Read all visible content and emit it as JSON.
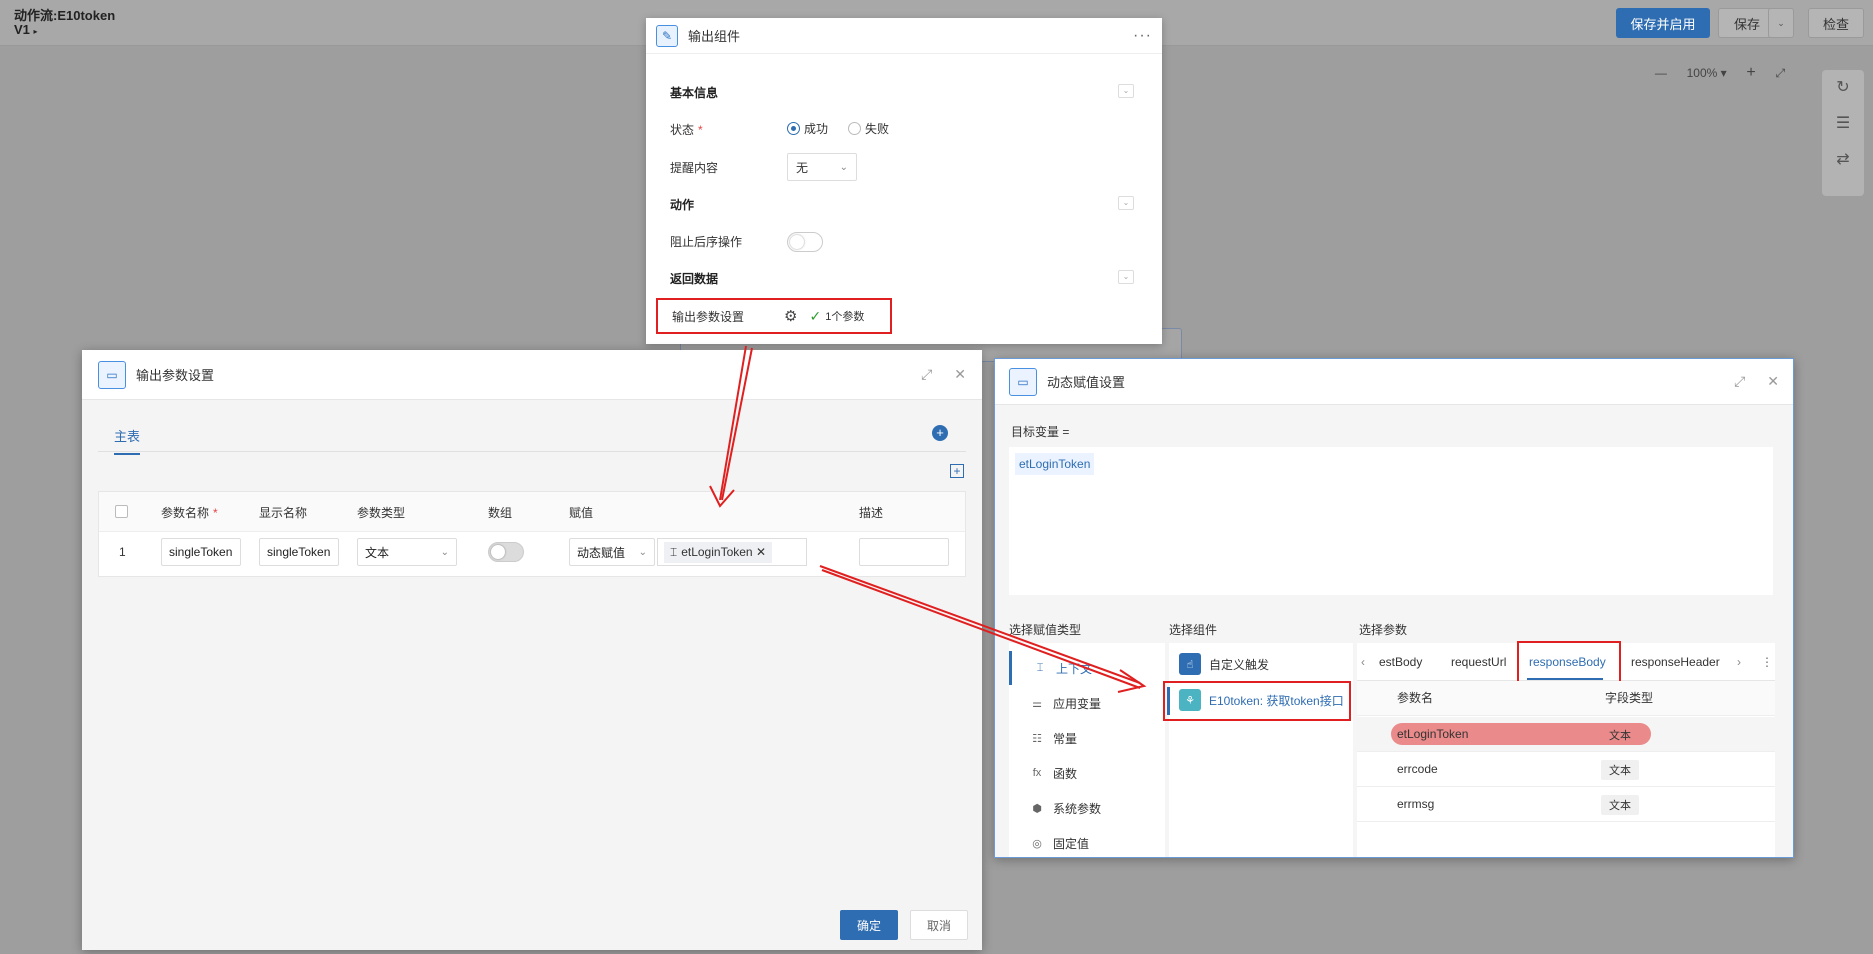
{
  "topbar": {
    "flow_title": "动作流:E10token",
    "version": "V1",
    "save_enable": "保存并启用",
    "save": "保存",
    "check": "检查"
  },
  "zoom": {
    "level": "100%"
  },
  "output_panel": {
    "title": "输出组件",
    "basic_info": "基本信息",
    "status_label": "状态",
    "status_success": "成功",
    "status_fail": "失败",
    "remind_label": "提醒内容",
    "remind_value": "无",
    "action_section": "动作",
    "block_label": "阻止后序操作",
    "return_section": "返回数据",
    "output_param_label": "输出参数设置",
    "param_count": "1个参数"
  },
  "param_dialog": {
    "title": "输出参数设置",
    "tab_main": "主表",
    "columns": [
      "参数名称",
      "显示名称",
      "参数类型",
      "数组",
      "赋值",
      "描述"
    ],
    "row": {
      "index": "1",
      "param_name": "singleToken",
      "display_name": "singleToken",
      "param_type": "文本",
      "assign_mode": "动态赋值",
      "assign_value": "etLoginToken",
      "desc": ""
    },
    "ok": "确定",
    "cancel": "取消"
  },
  "dynamic_dialog": {
    "title": "动态赋值设置",
    "target_label": "目标变量 =",
    "target_value": "etLoginToken",
    "col_type": "选择赋值类型",
    "col_component": "选择组件",
    "col_param": "选择参数",
    "types": [
      "上下文",
      "应用变量",
      "常量",
      "函数",
      "系统参数",
      "固定值"
    ],
    "components": [
      "自定义触发",
      "E10token: 获取token接口"
    ],
    "param_tabs": [
      "estBody",
      "requestUrl",
      "responseBody",
      "responseHeader"
    ],
    "param_header_name": "参数名",
    "param_header_type": "字段类型",
    "params": [
      {
        "name": "etLoginToken",
        "type": "文本"
      },
      {
        "name": "errcode",
        "type": "文本"
      },
      {
        "name": "errmsg",
        "type": "文本"
      }
    ]
  },
  "colors": {
    "primary": "#2f6db2",
    "highlight": "#e02020",
    "selected_row": "#ea8a8a"
  }
}
